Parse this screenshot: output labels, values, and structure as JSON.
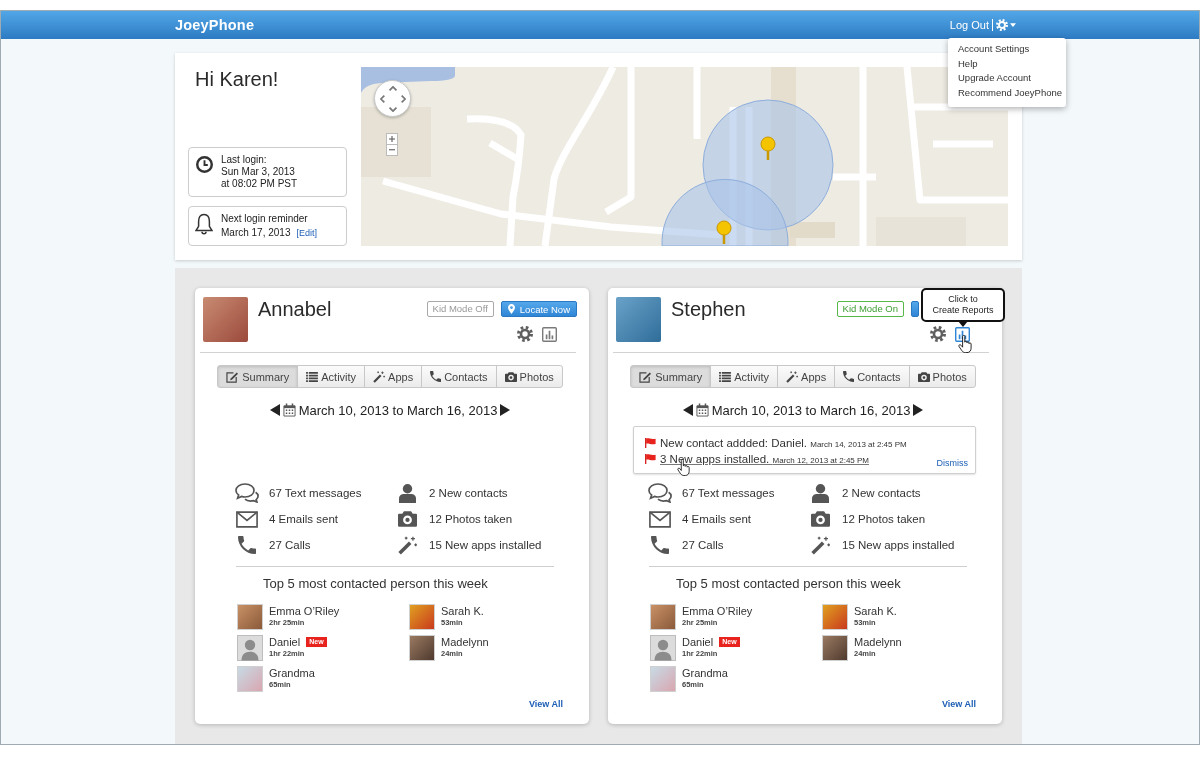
{
  "header": {
    "brand": "JoeyPhone",
    "logout": "Log Out"
  },
  "account_menu": {
    "expanded": true,
    "items": [
      "Account Settings",
      "Help",
      "Upgrade Account",
      "Recommend JoeyPhone"
    ]
  },
  "welcome": {
    "greeting": "Hi Karen!",
    "last_login": [
      "Last login:",
      "Sun Mar 3, 2013",
      "at 08:02 PM PST"
    ],
    "reminder": {
      "title": "Next login reminder",
      "date": "March 17, 2013",
      "edit_link": "[Edit]"
    }
  },
  "children": [
    {
      "name": "Annabel",
      "kid_mode": {
        "label": "Kid Mode Off",
        "on": false
      },
      "locate_button": {
        "label": "Locate Now",
        "covered": false
      },
      "reports_button": {
        "hovered": false
      },
      "tabs": [
        {
          "label": "Summary",
          "selected": true
        },
        {
          "label": "Activity",
          "selected": false
        },
        {
          "label": "Apps",
          "selected": false
        },
        {
          "label": "Contacts",
          "selected": false
        },
        {
          "label": "Photos",
          "selected": false
        }
      ],
      "date_range": "March 10, 2013 to March 16, 2013",
      "stats": [
        "67 Text messages",
        "2 New contacts",
        "4 Emails sent",
        "12 Photos taken",
        "27 Calls",
        "15 New apps installed"
      ],
      "top_contacts": {
        "title": "Top 5 most contacted person this week",
        "items": [
          {
            "name": "Emma O’Riley",
            "duration": "2hr 25min",
            "photo": true
          },
          {
            "name": "Sarah K.",
            "duration": "53min",
            "photo": true
          },
          {
            "name": "Daniel",
            "badge": "New",
            "duration": "1hr 22min",
            "photo": false
          },
          {
            "name": "Madelynn",
            "duration": "24min",
            "photo": true
          },
          {
            "name": "Grandma",
            "duration": "65min",
            "photo": true
          }
        ]
      },
      "view_all": "View All"
    },
    {
      "name": "Stephen",
      "kid_mode": {
        "label": "Kid Mode On",
        "on": true
      },
      "locate_button": {
        "covered": true
      },
      "reports_button": {
        "hovered": true
      },
      "tooltip": [
        "Click to",
        "Create Reports"
      ],
      "tabs": [
        {
          "label": "Summary",
          "selected": true
        },
        {
          "label": "Activity",
          "selected": false
        },
        {
          "label": "Apps",
          "selected": false
        },
        {
          "label": "Contacts",
          "selected": false
        },
        {
          "label": "Photos",
          "selected": false
        }
      ],
      "date_range": "March 10, 2013 to March 16, 2013",
      "alerts": {
        "items": [
          {
            "message": "New contact addded: Daniel.",
            "time": "March 14, 2013 at 2:45 PM",
            "hovered": false
          },
          {
            "message": "3 New apps installed.",
            "time": "March 12, 2013 at 2:45 PM",
            "hovered": true
          }
        ],
        "dismiss": "Dismiss"
      },
      "stats": [
        "67 Text messages",
        "2 New contacts",
        "4 Emails sent",
        "12 Photos taken",
        "27 Calls",
        "15 New apps installed"
      ],
      "top_contacts": {
        "title": "Top 5 most contacted person this week",
        "items": [
          {
            "name": "Emma O’Riley",
            "duration": "2hr 25min",
            "photo": true
          },
          {
            "name": "Sarah K.",
            "duration": "53min",
            "photo": true
          },
          {
            "name": "Daniel",
            "badge": "New",
            "duration": "1hr 22min",
            "photo": false
          },
          {
            "name": "Madelynn",
            "duration": "24min",
            "photo": true
          },
          {
            "name": "Grandma",
            "duration": "65min",
            "photo": true
          }
        ]
      },
      "view_all": "View All"
    }
  ]
}
